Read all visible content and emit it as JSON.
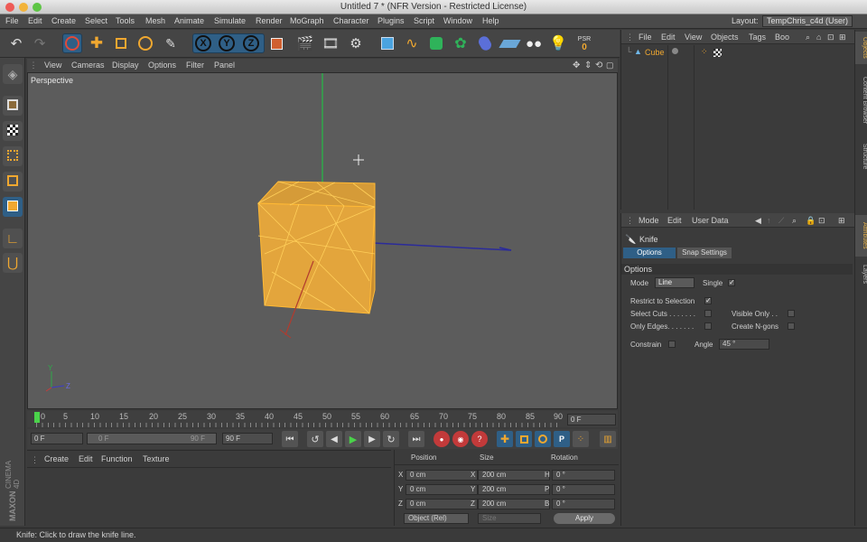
{
  "window": {
    "title": "Untitled 7 * (NFR Version - Restricted License)"
  },
  "menubar": {
    "items": [
      "File",
      "Edit",
      "Create",
      "Select",
      "Tools",
      "Mesh",
      "Animate",
      "Simulate",
      "Render",
      "MoGraph",
      "Character",
      "Plugins",
      "Script",
      "Window",
      "Help"
    ],
    "layout_label": "Layout:",
    "layout_value": "TempChris_c4d (User)"
  },
  "toolbar": {
    "icons": [
      "undo-icon",
      "redo-icon",
      "live-selection-icon",
      "move-icon",
      "scale-icon",
      "rotate-icon",
      "modeling-icon",
      "x-axis-icon",
      "y-axis-icon",
      "z-axis-icon",
      "world-coords-icon",
      "render-view-icon",
      "render-picture-viewer-icon",
      "edit-render-settings-icon",
      "cube-icon",
      "spline-icon",
      "nurbs-icon",
      "array-icon",
      "deformer-icon",
      "floor-icon",
      "camera-icon",
      "light-icon",
      "psr-icon"
    ],
    "axes": [
      "X",
      "Y",
      "Z"
    ],
    "psr_label": "PSR",
    "psr_value": "0"
  },
  "viewport": {
    "menu": [
      "View",
      "Cameras",
      "Display",
      "Options",
      "Filter",
      "Panel"
    ],
    "label": "Perspective",
    "gizmo_axes": [
      "Y",
      "Z"
    ]
  },
  "timeline": {
    "ticks": [
      "0",
      "5",
      "10",
      "15",
      "20",
      "25",
      "30",
      "35",
      "40",
      "45",
      "50",
      "55",
      "60",
      "65",
      "70",
      "75",
      "80",
      "85",
      "90"
    ],
    "current_frame": "0 F"
  },
  "transport": {
    "start_frame": "0 F",
    "range_start": "0 F",
    "range_end": "90 F",
    "end_frame": "90 F"
  },
  "materials": {
    "menu": [
      "Create",
      "Edit",
      "Function",
      "Texture"
    ]
  },
  "coordinates": {
    "headers": [
      "Position",
      "Size",
      "Rotation"
    ],
    "rows": [
      {
        "axis": "X",
        "pos": "0 cm",
        "size_axis": "X",
        "size": "200 cm",
        "rot_axis": "H",
        "rot": "0 °"
      },
      {
        "axis": "Y",
        "pos": "0 cm",
        "size_axis": "Y",
        "size": "200 cm",
        "rot_axis": "P",
        "rot": "0 °"
      },
      {
        "axis": "Z",
        "pos": "0 cm",
        "size_axis": "Z",
        "size": "200 cm",
        "rot_axis": "B",
        "rot": "0 °"
      }
    ],
    "mode": "Object (Rel)",
    "size_mode": "Size",
    "apply": "Apply"
  },
  "objects": {
    "menu": [
      "File",
      "Edit",
      "View",
      "Objects",
      "Tags",
      "Boo"
    ],
    "items": [
      {
        "name": "Cube"
      }
    ]
  },
  "attributes": {
    "menu": [
      "Mode",
      "Edit",
      "User Data"
    ],
    "tool_name": "Knife",
    "tabs": [
      "Options",
      "Snap Settings"
    ],
    "section": "Options",
    "mode_label": "Mode",
    "mode_value": "Line",
    "single_label": "Single",
    "restrict_label": "Restrict to Selection",
    "select_cuts_label": "Select Cuts . . . . . . .",
    "visible_only_label": "Visible Only . .",
    "only_edges_label": "Only Edges. . . . . . .",
    "create_ngons_label": "Create N-gons",
    "constrain_label": "Constrain",
    "angle_label": "Angle",
    "angle_value": "45 °"
  },
  "right_tabs": [
    "Objects",
    "Content Browser",
    "Structure",
    "Attributes",
    "Layers"
  ],
  "brand": {
    "maxon": "MAXON",
    "cinema": "CINEMA 4D"
  },
  "status": {
    "text": "Knife: Click to draw the knife line."
  },
  "colors": {
    "accent": "#e9b44a",
    "selection_blue": "#2f5f86",
    "cube_orange": "#f0a830"
  }
}
